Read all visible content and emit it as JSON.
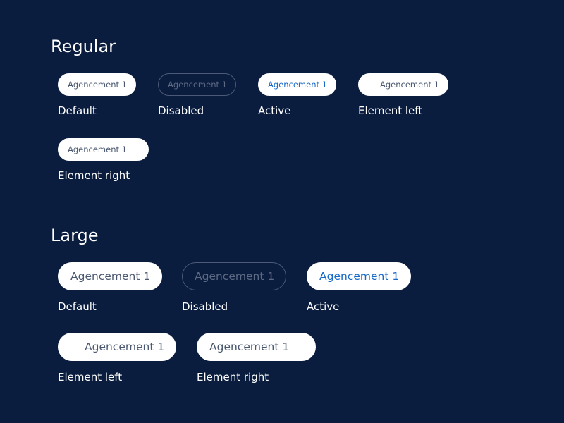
{
  "regular": {
    "title": "Regular",
    "chip_label": "Agencement 1",
    "states": {
      "default": "Default",
      "disabled": "Disabled",
      "active": "Active",
      "element_left": "Element left",
      "element_right": "Element right"
    }
  },
  "large": {
    "title": "Large",
    "chip_label": "Agencement 1",
    "states": {
      "default": "Default",
      "disabled": "Disabled",
      "active": "Active",
      "element_left": "Element left",
      "element_right": "Element right"
    }
  },
  "colors": {
    "background": "#0b1d3f",
    "chip_background": "#ffffff",
    "chip_text": "#4a5870",
    "active_text": "#1669c9",
    "disabled_border": "#4b5a76",
    "disabled_text": "#5d6a83",
    "label_text": "#ffffff"
  }
}
